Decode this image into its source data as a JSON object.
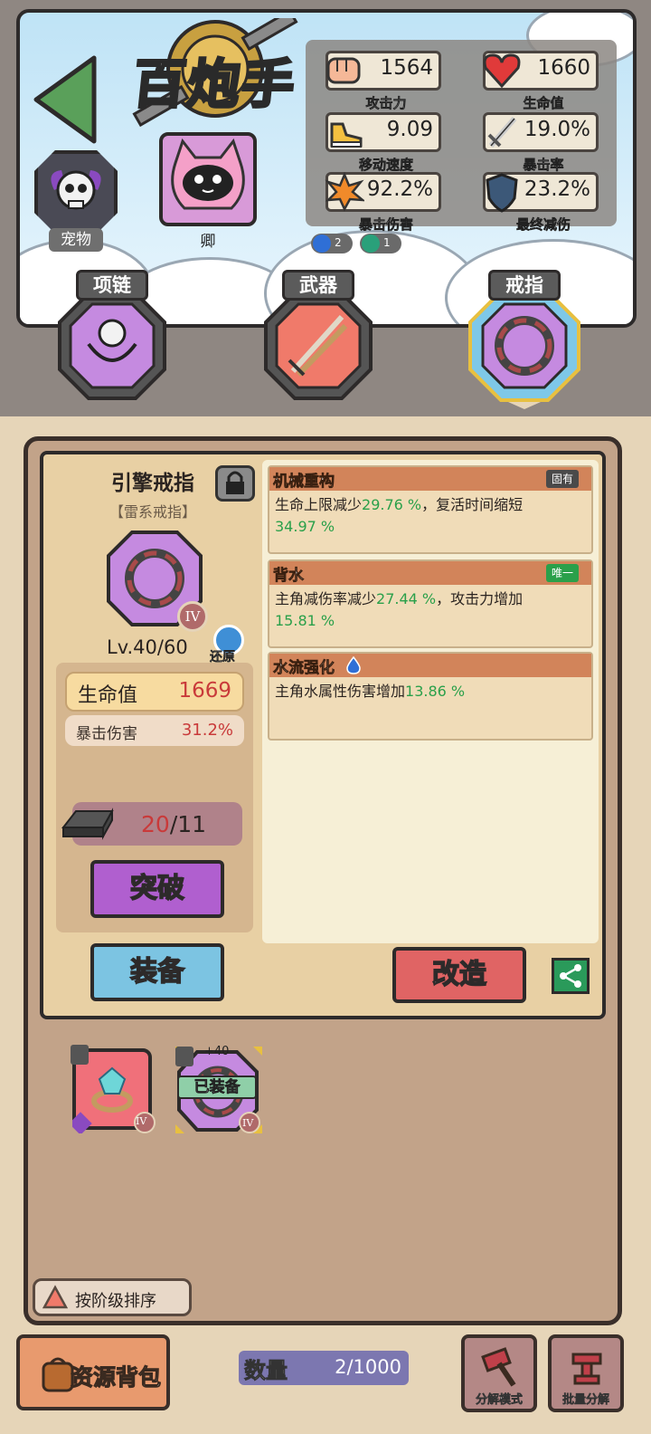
{
  "header": {
    "logo_text": "百炮手",
    "pet_label": "宠物",
    "character_label": "卿"
  },
  "stats": [
    {
      "key": "attack",
      "value": "1564",
      "label": "攻击力",
      "icon": "fist-icon"
    },
    {
      "key": "hp",
      "value": "1660",
      "label": "生命值",
      "icon": "heart-icon"
    },
    {
      "key": "speed",
      "value": "9.09",
      "label": "移动速度",
      "icon": "shoe-icon"
    },
    {
      "key": "crit_rate",
      "value": "19.0%",
      "label": "暴击率",
      "icon": "sword-icon"
    },
    {
      "key": "crit_dmg",
      "value": "92.2%",
      "label": "暴击伤害",
      "icon": "explosion-icon"
    },
    {
      "key": "final_reduction",
      "value": "23.2%",
      "label": "最终减伤",
      "icon": "shield-icon"
    }
  ],
  "buffs": [
    {
      "count": "2",
      "icon": "water-drop-icon",
      "color": "#2f6fd6"
    },
    {
      "count": "1",
      "icon": "wind-swirl-icon",
      "color": "#2aa07a"
    }
  ],
  "slots": [
    {
      "label": "项链",
      "icon": "skull-necklace-icon"
    },
    {
      "label": "武器",
      "icon": "katana-icon"
    },
    {
      "label": "戒指",
      "icon": "ring-icon"
    }
  ],
  "item": {
    "name": "引擎戒指",
    "type": "【雷系戒指】",
    "tier": "IV",
    "level": "Lv.40/60",
    "restore_label": "还原",
    "main_stat": {
      "label": "生命值",
      "value": "1669"
    },
    "sub_stat": {
      "label": "暴击伤害",
      "value": "31.2%"
    },
    "material": {
      "have": "20",
      "need": "/11"
    },
    "break_label": "突破",
    "equip_label": "装备",
    "reforge_label": "改造"
  },
  "affixes": [
    {
      "title": "机械重构",
      "tag": "固有",
      "tag_color": "#4a4a4a",
      "text_a": "生命上限减少",
      "val_a": "29.76 %",
      "text_b": "，复活时间缩短",
      "val_b": "34.97 %"
    },
    {
      "title": "背水",
      "tag": "唯一",
      "tag_color": "#2aa04a",
      "text_a": "主角减伤率减少",
      "val_a": "27.44 %",
      "text_b": "，攻击力增加",
      "val_b": "15.81 %"
    },
    {
      "title": "水流强化",
      "tag": "",
      "text_a": "主角水属性伤害增加",
      "val_a": "13.86 %",
      "text_b": "",
      "val_b": ""
    }
  ],
  "inventory": [
    {
      "tier": "IV",
      "badge": "",
      "equipped": false
    },
    {
      "tier": "IV",
      "badge": "+40",
      "equipped": true,
      "equipped_label": "已装备"
    }
  ],
  "sort_label": "按阶级排序",
  "bottom": {
    "resource_label": "资源背包",
    "qty_label": "数量",
    "qty_value": "2/1000",
    "decompose_mode": "分解模式",
    "batch_decompose": "批量分解"
  }
}
